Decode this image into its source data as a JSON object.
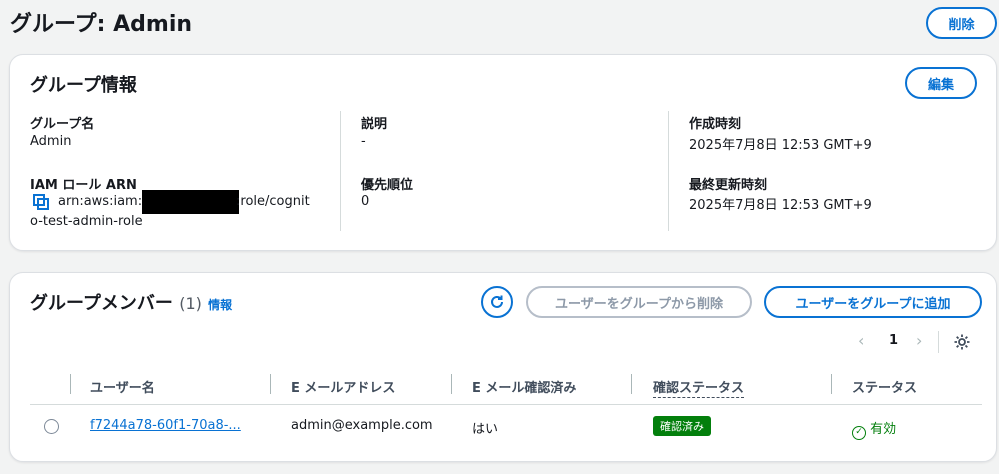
{
  "header": {
    "title": "グループ: Admin",
    "delete_label": "削除"
  },
  "group_info": {
    "title": "グループ情報",
    "edit_label": "編集",
    "group_name_label": "グループ名",
    "group_name_value": "Admin",
    "role_arn_label": "IAM ロール ARN",
    "role_arn_prefix": "arn:aws:iam::",
    "role_arn_suffix": ":role/cognit",
    "role_arn_line2": "o-test-admin-role",
    "description_label": "説明",
    "description_value": "-",
    "precedence_label": "優先順位",
    "precedence_value": "0",
    "created_label": "作成時刻",
    "created_value": "2025年7月8日 12:53 GMT+9",
    "updated_label": "最終更新時刻",
    "updated_value": "2025年7月8日 12:53 GMT+9"
  },
  "members": {
    "title": "グループメンバー",
    "count": "(1)",
    "info_label": "情報",
    "remove_label": "ユーザーをグループから削除",
    "add_label": "ユーザーをグループに追加",
    "page_number": "1",
    "columns": [
      "ユーザー名",
      "E メールアドレス",
      "E メール確認済み",
      "確認ステータス",
      "ステータス"
    ],
    "rows": [
      {
        "username": "f7244a78-60f1-70a8-...",
        "email": "admin@example.com",
        "email_verified": "はい",
        "confirmation_status": "確認済み",
        "status": "有効"
      }
    ]
  },
  "colors": {
    "accent": "#0972d3",
    "success": "#037f0c"
  }
}
